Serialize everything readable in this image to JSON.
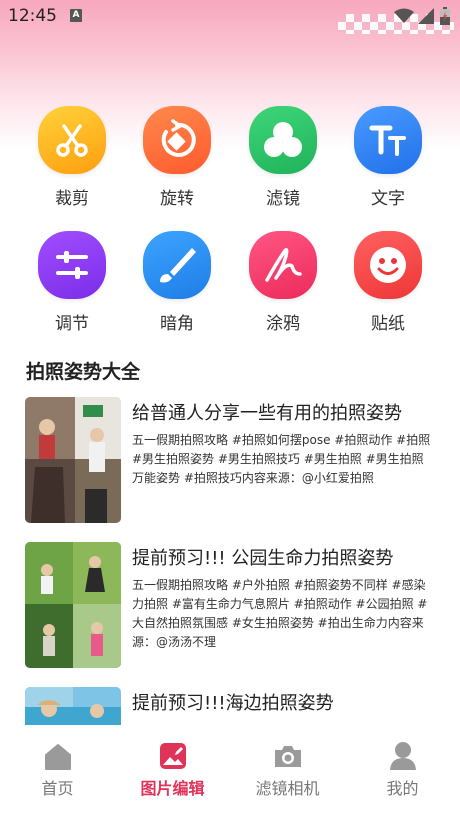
{
  "status_bar": {
    "time": "12:45",
    "notif_badge": "A"
  },
  "tools": [
    {
      "label": "裁剪",
      "icon": "scissors-icon",
      "color": "#ffb31a"
    },
    {
      "label": "旋转",
      "icon": "rotate-icon",
      "color": "#ff6d3a"
    },
    {
      "label": "滤镜",
      "icon": "filter-icon",
      "color": "#2bc466"
    },
    {
      "label": "文字",
      "icon": "text-icon",
      "color": "#2f82f5"
    },
    {
      "label": "调节",
      "icon": "adjust-icon",
      "color": "#8a3ef0"
    },
    {
      "label": "暗角",
      "icon": "brush-icon",
      "color": "#2b8ef0"
    },
    {
      "label": "涂鸦",
      "icon": "doodle-icon",
      "color": "#f43a6a"
    },
    {
      "label": "贴纸",
      "icon": "sticker-icon",
      "color": "#f44848"
    }
  ],
  "section_title": "拍照姿势大全",
  "articles": [
    {
      "title": "给普通人分享一些有用的拍照姿势",
      "desc": "五一假期拍照攻略 #拍照如何摆pose #拍照动作 #拍照 #男生拍照姿势 #男生拍照技巧 #男生拍照 #男生拍照万能姿势 #拍照技巧内容来源：@小红爱拍照"
    },
    {
      "title": "提前预习!!! 公园生命力拍照姿势",
      "desc": "五一假期拍照攻略 #户外拍照 #拍照姿势不同样 #感染力拍照 #富有生命力气息照片 #拍照动作 #公园拍照 #大自然拍照氛围感 #女生拍照姿势 #拍出生命力内容来源：@汤汤不理"
    },
    {
      "title": "提前预习!!!海边拍照姿势",
      "desc": ""
    }
  ],
  "nav": [
    {
      "label": "首页",
      "icon": "home-icon",
      "active": false
    },
    {
      "label": "图片编辑",
      "icon": "image-edit-icon",
      "active": true
    },
    {
      "label": "滤镜相机",
      "icon": "camera-icon",
      "active": false
    },
    {
      "label": "我的",
      "icon": "user-icon",
      "active": false
    }
  ],
  "colors": {
    "accent": "#e0335a",
    "nav_inactive": "#9a9a9a"
  }
}
